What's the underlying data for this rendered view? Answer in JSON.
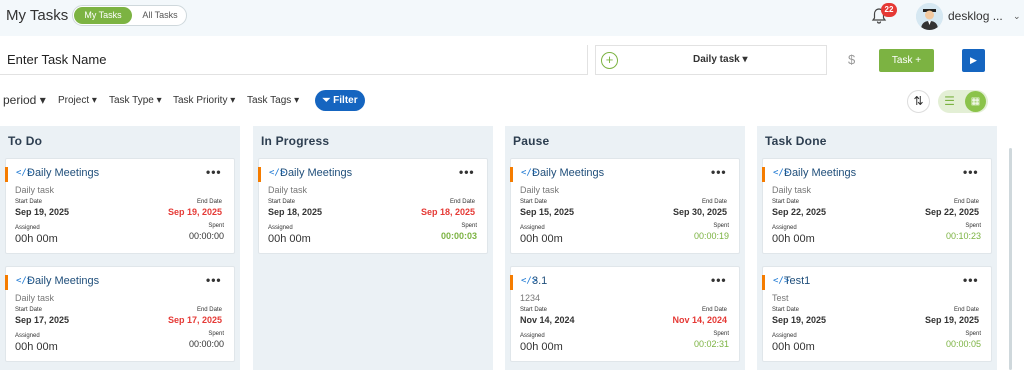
{
  "app": {
    "title": "My Tasks"
  },
  "header": {
    "toggle": {
      "active": "My Tasks",
      "inactive": "All Tasks"
    },
    "notifications": 22,
    "user": "desklog ..."
  },
  "new_task": {
    "placeholder": "Enter Task Name",
    "type": "Daily task",
    "currency": "$",
    "add_button": "Task +"
  },
  "filters": {
    "period": "period",
    "project": "Project",
    "task_type": "Task Type",
    "task_priority": "Task Priority",
    "task_tags": "Task Tags",
    "filter_button": "Filter"
  },
  "labels": {
    "start": "Start Date",
    "end": "End Date",
    "assigned": "Assigned",
    "spent": "Spent"
  },
  "columns": [
    {
      "title": "To Do",
      "cards": [
        {
          "title": "Daily Meetings",
          "type": "Daily task",
          "start": "Sep 19, 2025",
          "end": "Sep 19, 2025",
          "assigned": "00h 00m",
          "spent": "00:00:00"
        },
        {
          "title": "Daily Meetings",
          "type": "Daily task",
          "start": "Sep 17, 2025",
          "end": "Sep 17, 2025",
          "assigned": "00h 00m",
          "spent": "00:00:00"
        }
      ]
    },
    {
      "title": "In Progress",
      "cards": [
        {
          "title": "Daily Meetings",
          "type": "Daily task",
          "start": "Sep 18, 2025",
          "end": "Sep 18, 2025",
          "assigned": "00h 00m",
          "spent": "00:00:03"
        }
      ]
    },
    {
      "title": "Pause",
      "cards": [
        {
          "title": "Daily Meetings",
          "type": "Daily task",
          "start": "Sep 15, 2025",
          "end": "Sep 30, 2025",
          "assigned": "00h 00m",
          "spent": "00:00:19"
        },
        {
          "title": "3.1",
          "type": "1234",
          "start": "Nov 14, 2024",
          "end": "Nov 14, 2024",
          "assigned": "00h 00m",
          "spent": "00:02:31"
        }
      ]
    },
    {
      "title": "Task Done",
      "cards": [
        {
          "title": "Daily Meetings",
          "type": "Daily task",
          "start": "Sep 22, 2025",
          "end": "Sep 22, 2025",
          "assigned": "00h 00m",
          "spent": "00:10:23"
        },
        {
          "title": "Test1",
          "type": "Test",
          "start": "Sep 19, 2025",
          "end": "Sep 19, 2025",
          "assigned": "00h 00m",
          "spent": "00:00:05"
        }
      ]
    }
  ],
  "colors": {
    "accent_green": "#7cb342",
    "primary_blue": "#1565c0",
    "overdue_red": "#e53935",
    "card_accent": "#f57c00"
  }
}
